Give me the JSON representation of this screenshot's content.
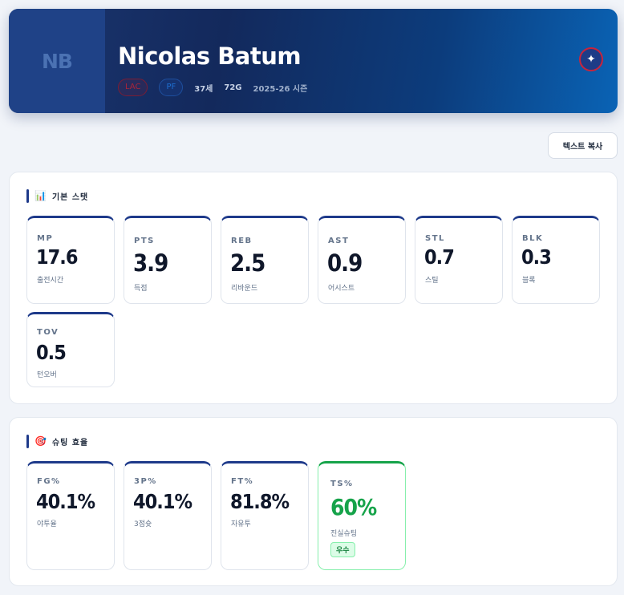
{
  "player": {
    "initials": "NB",
    "name": "Nicolas Batum",
    "team": "LAC",
    "position": "PF",
    "age": "37세",
    "games": "72G",
    "season": "2025-26 시즌"
  },
  "actions": {
    "copy_text_label": "텍스트 복사"
  },
  "basic_stats": {
    "title": "기본 스탯",
    "icon": "bar-chart-icon",
    "items": [
      {
        "abbr": "MP",
        "value": "17.6",
        "label": "출전시간"
      },
      {
        "abbr": "PTS",
        "value": "3.9",
        "label": "득점"
      },
      {
        "abbr": "REB",
        "value": "2.5",
        "label": "리바운드"
      },
      {
        "abbr": "AST",
        "value": "0.9",
        "label": "어시스트"
      },
      {
        "abbr": "STL",
        "value": "0.7",
        "label": "스틸"
      },
      {
        "abbr": "BLK",
        "value": "0.3",
        "label": "블록"
      },
      {
        "abbr": "TOV",
        "value": "0.5",
        "label": "턴오버"
      }
    ]
  },
  "shooting": {
    "title": "슈팅 효율",
    "icon": "target-icon",
    "items": [
      {
        "abbr": "FG%",
        "value": "40.1%",
        "label": "야투율"
      },
      {
        "abbr": "3P%",
        "value": "40.1%",
        "label": "3점슛"
      },
      {
        "abbr": "FT%",
        "value": "81.8%",
        "label": "자유투"
      },
      {
        "abbr": "TS%",
        "value": "60%",
        "label": "진실슈팅",
        "badge": "우수"
      }
    ]
  },
  "colors": {
    "accent": "#1e3a8a",
    "good": "#16a34a",
    "team": "#c8243c"
  }
}
